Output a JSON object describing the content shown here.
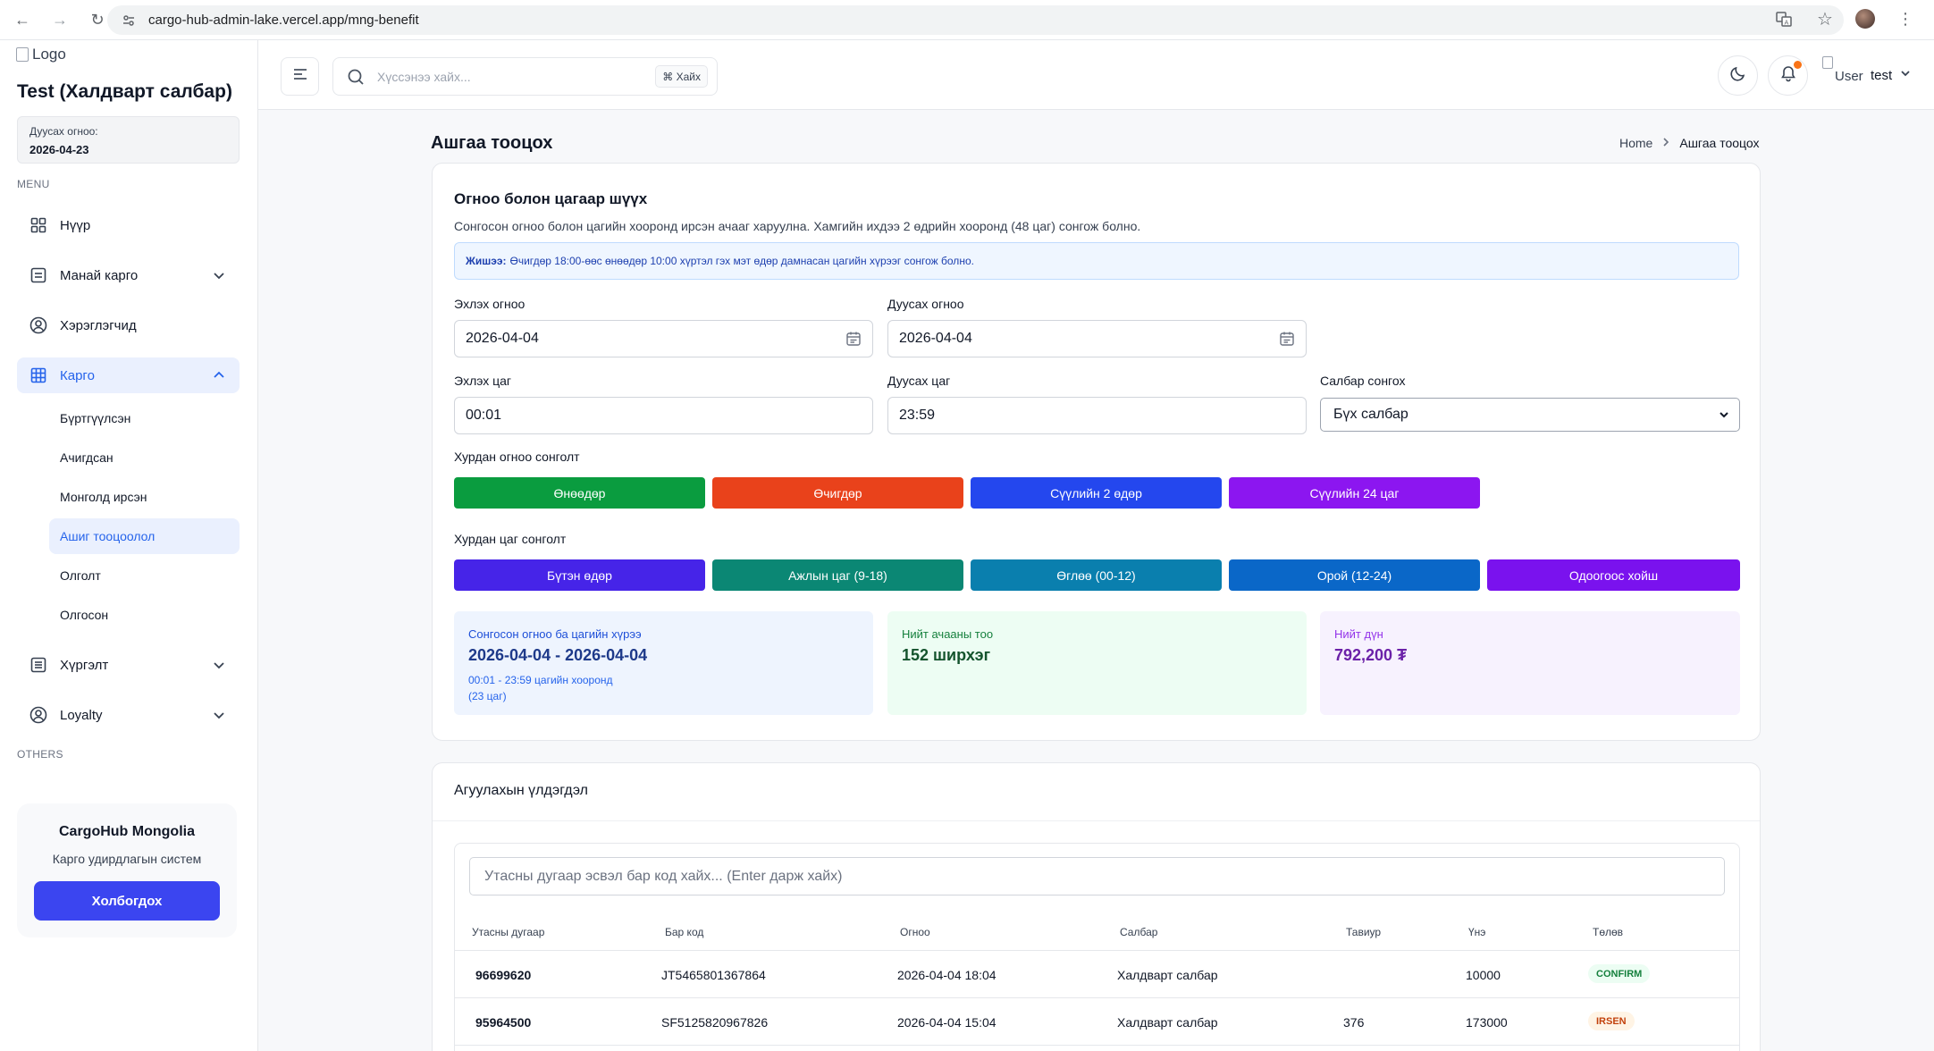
{
  "browser": {
    "url": "cargo-hub-admin-lake.vercel.app/mng-benefit"
  },
  "sidebar": {
    "logo_alt": "Logo",
    "org_title": "Test (Халдварт салбар)",
    "expire_label": "Дуусах огноо:",
    "expire_value": "2026-04-23",
    "menu_label": "MENU",
    "others_label": "OTHERS",
    "items": [
      {
        "label": "Нүүр"
      },
      {
        "label": "Манай карго"
      },
      {
        "label": "Хэрэглэгчид"
      },
      {
        "label": "Карго"
      },
      {
        "label": "Хүргэлт"
      },
      {
        "label": "Loyalty"
      }
    ],
    "cargo_sub": [
      {
        "label": "Бүртгүүлсэн"
      },
      {
        "label": "Ачигдсан"
      },
      {
        "label": "Монголд ирсэн"
      },
      {
        "label": "Ашиг тооцоолол"
      },
      {
        "label": "Олголт"
      },
      {
        "label": "Олгосон"
      }
    ],
    "promo": {
      "title": "CargoHub Mongolia",
      "subtitle": "Карго удирдлагын систем",
      "button": "Холбогдох"
    }
  },
  "header": {
    "search_placeholder": "Хүссэнээ хайх...",
    "search_shortcut": "⌘ Хайх",
    "user_img_alt": "User",
    "user_name": "test"
  },
  "page": {
    "title": "Ашгаа тооцох",
    "breadcrumb_home": "Home",
    "breadcrumb_current": "Ашгаа тооцох"
  },
  "filter": {
    "title": "Огноо болон цагаар шүүх",
    "description": "Сонгосон огноо болон цагийн хооронд ирсэн ачааг харуулна. Хамгийн ихдээ 2 өдрийн хооронд (48 цаг) сонгож болно.",
    "hint_bold": "Жишээ:",
    "hint_text": "Өчигдөр 18:00-өөс өнөөдөр 10:00 хүртэл гэх мэт өдөр дамнасан цагийн хүрээг сонгож болно.",
    "start_date_label": "Эхлэх огноо",
    "start_date": "2026-04-04",
    "end_date_label": "Дуусах огноо",
    "end_date": "2026-04-04",
    "start_time_label": "Эхлэх цаг",
    "start_time": "00:01",
    "end_time_label": "Дуусах цаг",
    "end_time": "23:59",
    "branch_label": "Салбар сонгох",
    "branch_value": "Бүх салбар",
    "quick_date_label": "Хурдан огноо сонголт",
    "quick_dates": [
      {
        "label": "Өнөөдөр",
        "color": "#0a9c3f"
      },
      {
        "label": "Өчигдөр",
        "color": "#e9421b"
      },
      {
        "label": "Сүүлийн 2 өдөр",
        "color": "#2447ee"
      },
      {
        "label": "Сүүлийн 24 цаг",
        "color": "#8c16f0"
      }
    ],
    "quick_time_label": "Хурдан цаг сонголт",
    "quick_times": [
      {
        "label": "Бүтэн өдөр",
        "color": "#4624e8"
      },
      {
        "label": "Ажлын цаг (9-18)",
        "color": "#0b8774"
      },
      {
        "label": "Өглөө (00-12)",
        "color": "#0a7fae"
      },
      {
        "label": "Орой (12-24)",
        "color": "#0a67c8"
      },
      {
        "label": "Одоогоос хойш",
        "color": "#7a12ee"
      }
    ]
  },
  "stats": {
    "range_label": "Сонгосон огноо ба цагийн хүрээ",
    "range_value": "2026-04-04 - 2026-04-04",
    "range_detail": "00:01 - 23:59 цагийн хооронд",
    "range_hours": "(23 цаг)",
    "count_label": "Нийт ачааны тоо",
    "count_value": "152 ширхэг",
    "total_label": "Нийт дүн",
    "total_value": "792,200 ₮",
    "colors": {
      "range_bg": "#eef4fe",
      "range_fg": "#1e3a8a",
      "count_bg": "#edfdf3",
      "count_fg": "#14532d",
      "total_bg": "#f7f2fe",
      "total_fg": "#6b21a8"
    }
  },
  "inventory": {
    "title": "Агуулахын үлдэгдэл",
    "search_placeholder": "Утасны дугаар эсвэл бар код хайх... (Enter дарж хайх)",
    "columns": [
      "Утасны дугаар",
      "Бар код",
      "Огноо",
      "Салбар",
      "Тавиур",
      "Үнэ",
      "Төлөв"
    ],
    "rows": [
      {
        "phone": "96699620",
        "barcode": "JT5465801367864",
        "date": "2026-04-04 18:04",
        "branch": "Халдварт салбар",
        "shelf": "",
        "price": "10000",
        "status": "CONFIRM"
      },
      {
        "phone": "95964500",
        "barcode": "SF5125820967826",
        "date": "2026-04-04 15:04",
        "branch": "Халдварт салбар",
        "shelf": "376",
        "price": "173000",
        "status": "IRSEN"
      }
    ]
  }
}
